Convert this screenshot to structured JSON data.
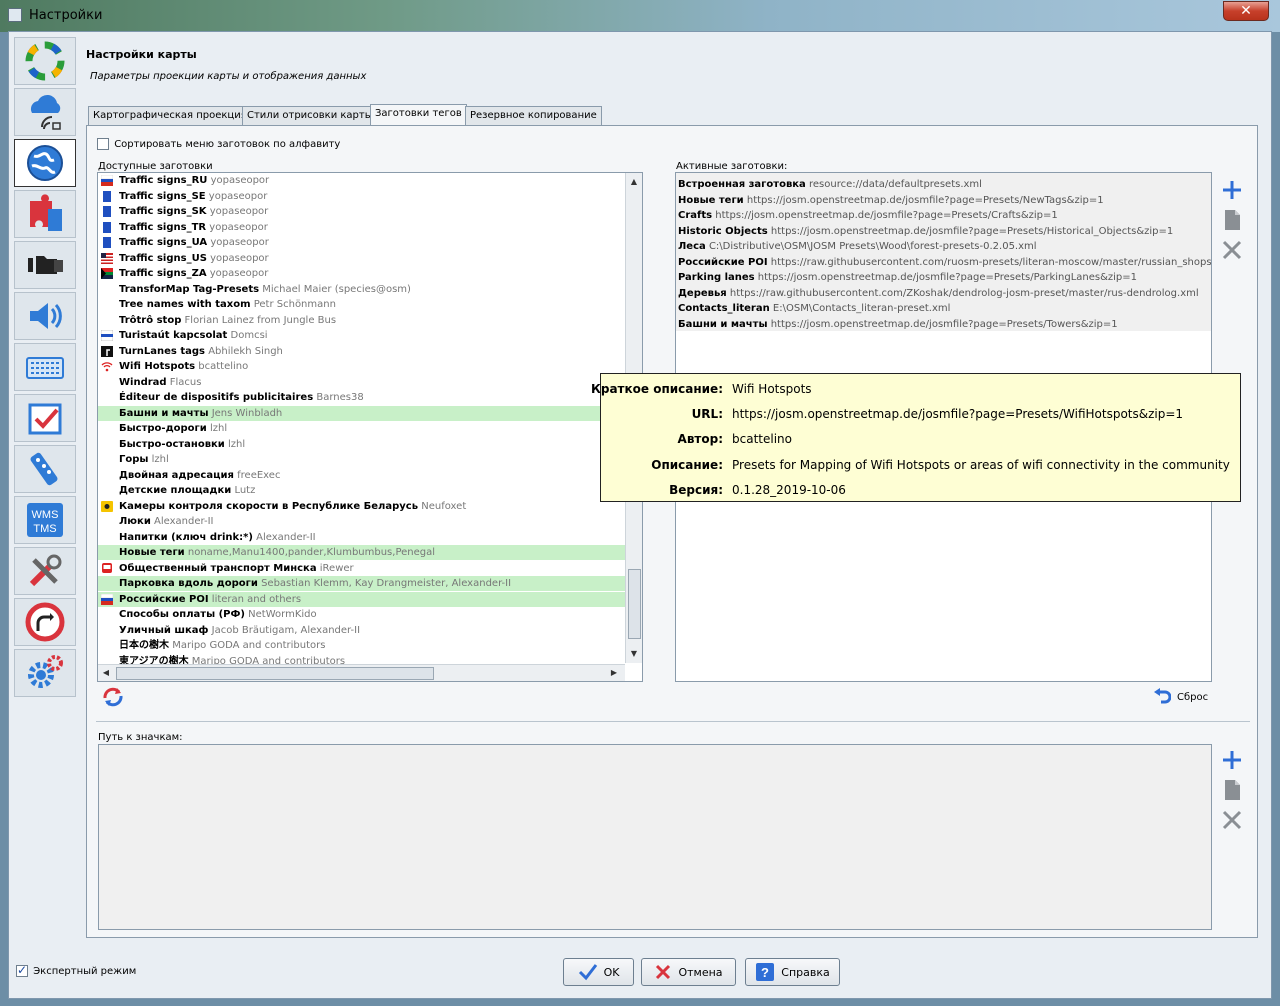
{
  "window": {
    "title": "Настройки",
    "close_glyph": "✕"
  },
  "header": {
    "title": "Настройки карты",
    "subtitle": "Параметры проекции карты и отображения данных"
  },
  "tabs": [
    {
      "label": "Картографическая проекция"
    },
    {
      "label": "Стили отрисовки карты"
    },
    {
      "label": "Заготовки тегов"
    },
    {
      "label": "Резервное копирование"
    }
  ],
  "sort_checkbox": {
    "label": "Сортировать меню заготовок по алфавиту",
    "checked": false
  },
  "available": {
    "label": "Доступные заготовки",
    "items": [
      {
        "name": "Traffic signs_RU",
        "author": "yopaseopor",
        "icon": "flag-ru-icon",
        "highlight": false
      },
      {
        "name": "Traffic signs_SE",
        "author": "yopaseopor",
        "icon": "sign-se-icon",
        "highlight": false
      },
      {
        "name": "Traffic signs_SK",
        "author": "yopaseopor",
        "icon": "sign-sk-icon",
        "highlight": false
      },
      {
        "name": "Traffic signs_TR",
        "author": "yopaseopor",
        "icon": "sign-tr-icon",
        "highlight": false
      },
      {
        "name": "Traffic signs_UA",
        "author": "yopaseopor",
        "icon": "sign-ua-icon",
        "highlight": false
      },
      {
        "name": "Traffic signs_US",
        "author": "yopaseopor",
        "icon": "flag-us-icon",
        "highlight": false
      },
      {
        "name": "Traffic signs_ZA",
        "author": "yopaseopor",
        "icon": "flag-za-icon",
        "highlight": false
      },
      {
        "name": "TransforMap Tag-Presets",
        "author": "Michael Maier (species@osm)",
        "icon": "",
        "highlight": false
      },
      {
        "name": "Tree names with taxom",
        "author": "Petr Schönmann",
        "icon": "",
        "highlight": false
      },
      {
        "name": "Trôtrô stop",
        "author": "Florian Lainez from Jungle Bus",
        "icon": "",
        "highlight": false
      },
      {
        "name": "Turistaút kapcsolat",
        "author": "Domcsi",
        "icon": "flag-hu-trail-icon",
        "highlight": false
      },
      {
        "name": "TurnLanes tags",
        "author": "Abhilekh Singh",
        "icon": "turn-lanes-icon",
        "highlight": false
      },
      {
        "name": "Wifi Hotspots",
        "author": "bcattelino",
        "icon": "wifi-icon",
        "highlight": false
      },
      {
        "name": "Windrad",
        "author": "Flacus",
        "icon": "",
        "highlight": false
      },
      {
        "name": "Éditeur de dispositifs publicitaires",
        "author": "Barnes38",
        "icon": "",
        "highlight": false
      },
      {
        "name": "Башни и мачты",
        "author": "Jens Winbladh",
        "icon": "",
        "highlight": true
      },
      {
        "name": "Быстро-дороги",
        "author": "lzhl",
        "icon": "",
        "highlight": false
      },
      {
        "name": "Быстро-остановки",
        "author": "lzhl",
        "icon": "",
        "highlight": false
      },
      {
        "name": "Горы",
        "author": "lzhl",
        "icon": "",
        "highlight": false
      },
      {
        "name": "Двойная адресация",
        "author": "freeExec",
        "icon": "",
        "highlight": false
      },
      {
        "name": "Детские площадки",
        "author": "Lutz",
        "icon": "",
        "highlight": false
      },
      {
        "name": "Камеры контроля скорости в Республике Беларусь",
        "author": "Neufoxet",
        "icon": "speed-camera-icon",
        "highlight": false
      },
      {
        "name": "Люки",
        "author": "Alexander-II",
        "icon": "",
        "highlight": false
      },
      {
        "name": "Напитки (ключ drink:*)",
        "author": "Alexander-II",
        "icon": "",
        "highlight": false
      },
      {
        "name": "Новые теги",
        "author": "noname,Manu1400,pander,Klumbumbus,Penegal",
        "icon": "",
        "highlight": true
      },
      {
        "name": "Общественный транспорт Минска",
        "author": "iRewer",
        "icon": "bus-icon",
        "highlight": false
      },
      {
        "name": "Парковка вдоль дороги",
        "author": "Sebastian Klemm, Kay Drangmeister, Alexander-II",
        "icon": "",
        "highlight": true
      },
      {
        "name": "Российские POI",
        "author": "literan and others",
        "icon": "flag-ru-icon",
        "highlight": true
      },
      {
        "name": "Способы оплаты (РФ)",
        "author": "NetWormKido",
        "icon": "",
        "highlight": false
      },
      {
        "name": "Уличный шкаф",
        "author": "Jacob Bräutigam, Alexander-II",
        "icon": "",
        "highlight": false
      },
      {
        "name": "日本の樹木",
        "author": "Maripo GODA and contributors",
        "icon": "",
        "highlight": false
      },
      {
        "name": "東アジアの樹木",
        "author": "Maripo GODA and contributors",
        "icon": "",
        "highlight": false
      }
    ]
  },
  "active": {
    "label": "Активные заготовки:",
    "items": [
      {
        "name": "Встроенная заготовка",
        "src": "resource://data/defaultpresets.xml"
      },
      {
        "name": "Новые теги",
        "src": "https://josm.openstreetmap.de/josmfile?page=Presets/NewTags&zip=1"
      },
      {
        "name": "Crafts",
        "src": "https://josm.openstreetmap.de/josmfile?page=Presets/Crafts&zip=1"
      },
      {
        "name": "Historic Objects",
        "src": "https://josm.openstreetmap.de/josmfile?page=Presets/Historical_Objects&zip=1"
      },
      {
        "name": "Леса",
        "src": "C:\\Distributive\\OSM\\JOSM Presets\\Wood\\forest-presets-0.2.05.xml"
      },
      {
        "name": "Российские POI",
        "src": "https://raw.githubusercontent.com/ruosm-presets/literan-moscow/master/russian_shops.xml"
      },
      {
        "name": "Parking lanes",
        "src": "https://josm.openstreetmap.de/josmfile?page=Presets/ParkingLanes&zip=1"
      },
      {
        "name": "Деревья",
        "src": "https://raw.githubusercontent.com/ZKoshak/dendrolog-josm-preset/master/rus-dendrolog.xml"
      },
      {
        "name": "Contacts_literan",
        "src": "E:\\OSM\\Contacts_literan-preset.xml"
      },
      {
        "name": "Башни и мачты",
        "src": "https://josm.openstreetmap.de/josmfile?page=Presets/Towers&zip=1"
      }
    ]
  },
  "tooltip": {
    "rows": [
      {
        "key": "Краткое описание:",
        "value": "Wifi Hotspots"
      },
      {
        "key": "URL:",
        "value": "https://josm.openstreetmap.de/josmfile?page=Presets/WifiHotspots&zip=1"
      },
      {
        "key": "Автор:",
        "value": "bcattelino"
      },
      {
        "key": "Описание:",
        "value": "Presets for Mapping of Wifi Hotspots or areas of wifi connectivity in the community"
      },
      {
        "key": "Версия:",
        "value": "0.1.28_2019-10-06"
      }
    ]
  },
  "reset_label": "Сброс",
  "icon_path": {
    "label": "Путь к значкам:"
  },
  "expert_mode": {
    "label": "Экспертный режим",
    "checked": true
  },
  "buttons": {
    "ok": "OK",
    "cancel": "Отмена",
    "help": "Справка"
  },
  "sidebar_icons": [
    "display-settings-icon",
    "server-connection-icon",
    "map-settings-icon",
    "plugins-icon",
    "file-connections-icon",
    "audio-icon",
    "shortcuts-icon",
    "validator-icon",
    "remote-control-icon",
    "wms-tms-icon",
    "advanced-tools-icon",
    "no-entry-icon",
    "advanced-preferences-icon"
  ],
  "wms_text": [
    "WMS",
    "TMS"
  ],
  "colors": {
    "highlight": "#c8f0c8",
    "tooltip_bg": "#fefed4",
    "accent": "#2f6ed6"
  }
}
